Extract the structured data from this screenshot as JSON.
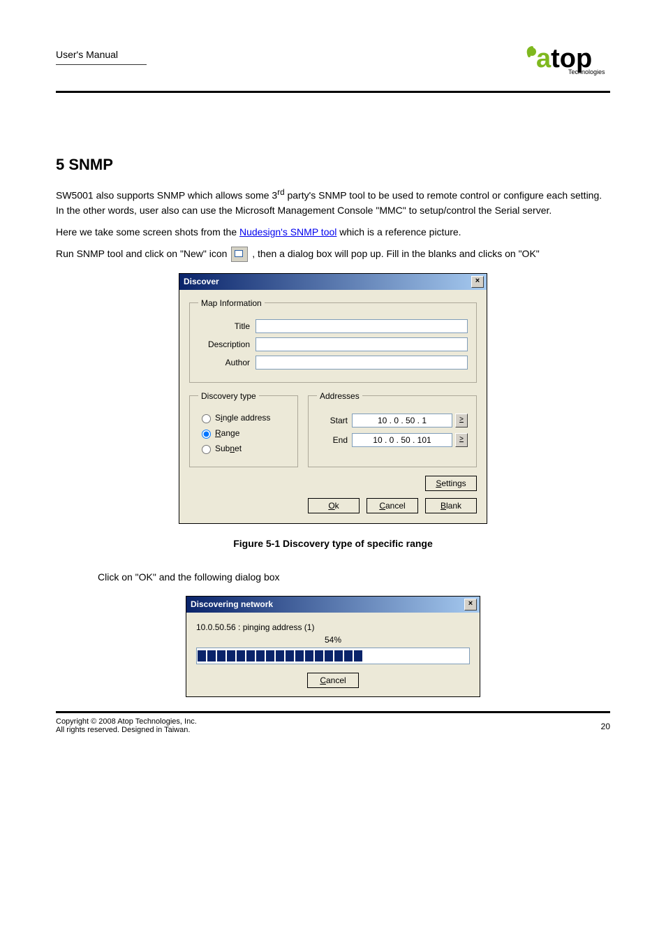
{
  "header": {
    "small_title": "User's Manual",
    "logo_brand": "atop",
    "logo_sub": "Technologies"
  },
  "section": {
    "heading": "5 SNMP",
    "para1_prefix": "SW5001 also supports SNMP which allows some 3",
    "para1_super": "rd",
    "para1_suffix": " party's SNMP tool to be used to remote control or configure each setting. In the other words, user also can use the Microsoft Management Console \"MMC\" to setup/control the Serial server.",
    "para2_pre": "Here we take some screen shots from the ",
    "link_text": "Nudesign's SNMP tool",
    "para2_post": " which is a reference picture."
  },
  "run": {
    "step1_prefix": "Run SNMP tool and click on \"New\" icon ",
    "step1_suffix": ", then a dialog box will pop up. Fill in the blanks and clicks on \"OK\""
  },
  "dialog1": {
    "title": "Discover",
    "group_map": "Map Information",
    "lbl_title": "Title",
    "lbl_description": "Description",
    "lbl_author": "Author",
    "val_title": "",
    "val_description": "",
    "val_author": "",
    "group_disc": "Discovery type",
    "radio_single": "Single address",
    "radio_range": "Range",
    "radio_subnet": "Subnet",
    "group_addr": "Addresses",
    "lbl_start": "Start",
    "lbl_end": "End",
    "ip_start": "10  .   0   .  50  .   1",
    "ip_end": "10  .   0   .  50  . 101",
    "btn_settings": "Settings",
    "btn_ok": "Ok",
    "btn_cancel": "Cancel",
    "btn_blank": "Blank"
  },
  "caption1": "Figure 5-1  Discovery type of specific range",
  "mid_text": "Click on \"OK\" and the following dialog box",
  "dialog2": {
    "title": "Discovering network",
    "status": "10.0.50.56 : pinging address (1)",
    "percent": "54%",
    "blocks": 17,
    "btn_cancel": "Cancel"
  },
  "footer": {
    "copyright": "Copyright © 2008 Atop Technologies, Inc.",
    "reserved": "All rights reserved. Designed in Taiwan.",
    "page_num": "20"
  }
}
